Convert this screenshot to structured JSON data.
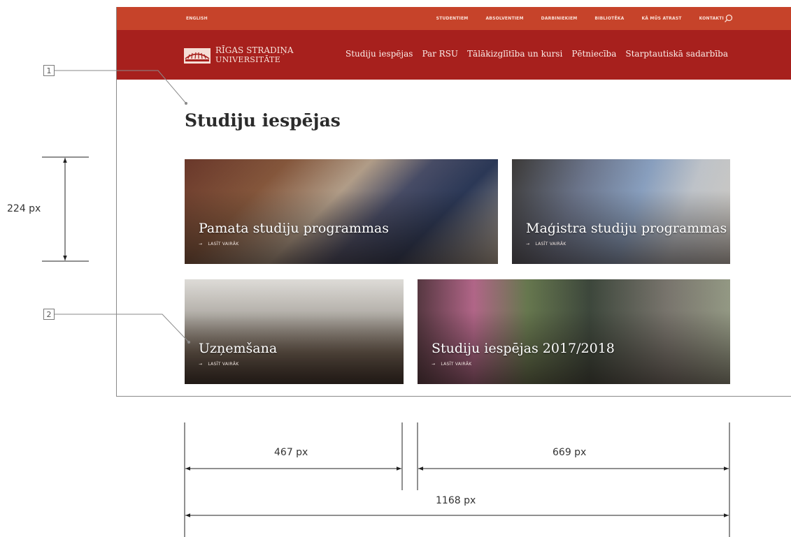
{
  "site": {
    "topbar": {
      "language": "ENGLISH",
      "links": [
        "STUDENTIEM",
        "ABSOLVENTIEM",
        "DARBINIEKIEM",
        "BIBLIOTĒKA",
        "KĀ MŪS ATRAST",
        "KONTAKTI"
      ],
      "search_icon": "search-icon",
      "color": "#c6432a"
    },
    "logo": {
      "line1": "RĪGAS STRADIŅA",
      "line2": "UNIVERSITĀTE"
    },
    "nav": {
      "color": "#a7201d",
      "items": [
        "Studiju iespējas",
        "Par RSU",
        "Tālākizglītība un kursi",
        "Pētniecība",
        "Starptautiskā sadarbība"
      ]
    },
    "page_title": "Studiju iespējas",
    "cards": [
      {
        "title": "Pamata studiju programmas",
        "more": "LASĪT VAIRĀK"
      },
      {
        "title": "Maģistra studiju programmas",
        "more": "LASĪT VAIRĀK"
      },
      {
        "title": "Uzņemšana",
        "more": "LASĪT VAIRĀK"
      },
      {
        "title": "Studiju iespējas 2017/2018",
        "more": "LASĪT VAIRĀK"
      }
    ],
    "arrow": "→"
  },
  "annotations": {
    "callout1": "1",
    "callout2": "2",
    "height_label": "224 px",
    "width_small": "467 px",
    "width_large": "669 px",
    "width_total": "1168 px"
  }
}
